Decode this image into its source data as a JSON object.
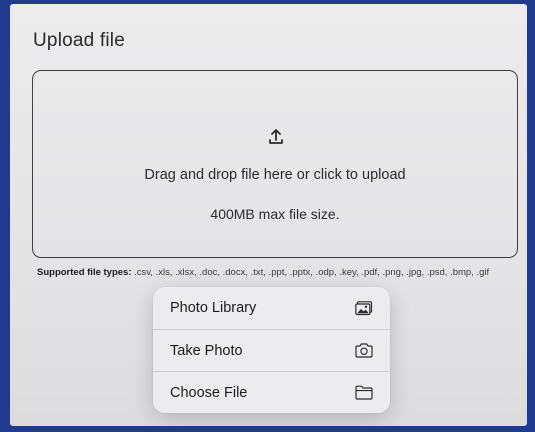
{
  "page": {
    "title": "Upload file"
  },
  "dropzone": {
    "icon": "upload-icon",
    "instruction": "Drag and drop file here or click to upload",
    "max_size": "400MB max file size."
  },
  "supported": {
    "label": "Supported file types:",
    "types": " .csv, .xls, .xlsx, .doc, .docx, .txt, .ppt, .pptx, .odp, .key, .pdf, .png, .jpg, .psd, .bmp, .gif"
  },
  "menu": {
    "items": [
      {
        "label": "Photo Library",
        "icon": "photo-library-icon"
      },
      {
        "label": "Take Photo",
        "icon": "camera-icon"
      },
      {
        "label": "Choose File",
        "icon": "folder-icon"
      }
    ]
  },
  "colors": {
    "frame": "#1f3a8f",
    "background": "#e8e8ea",
    "text": "#2b2b2d"
  }
}
